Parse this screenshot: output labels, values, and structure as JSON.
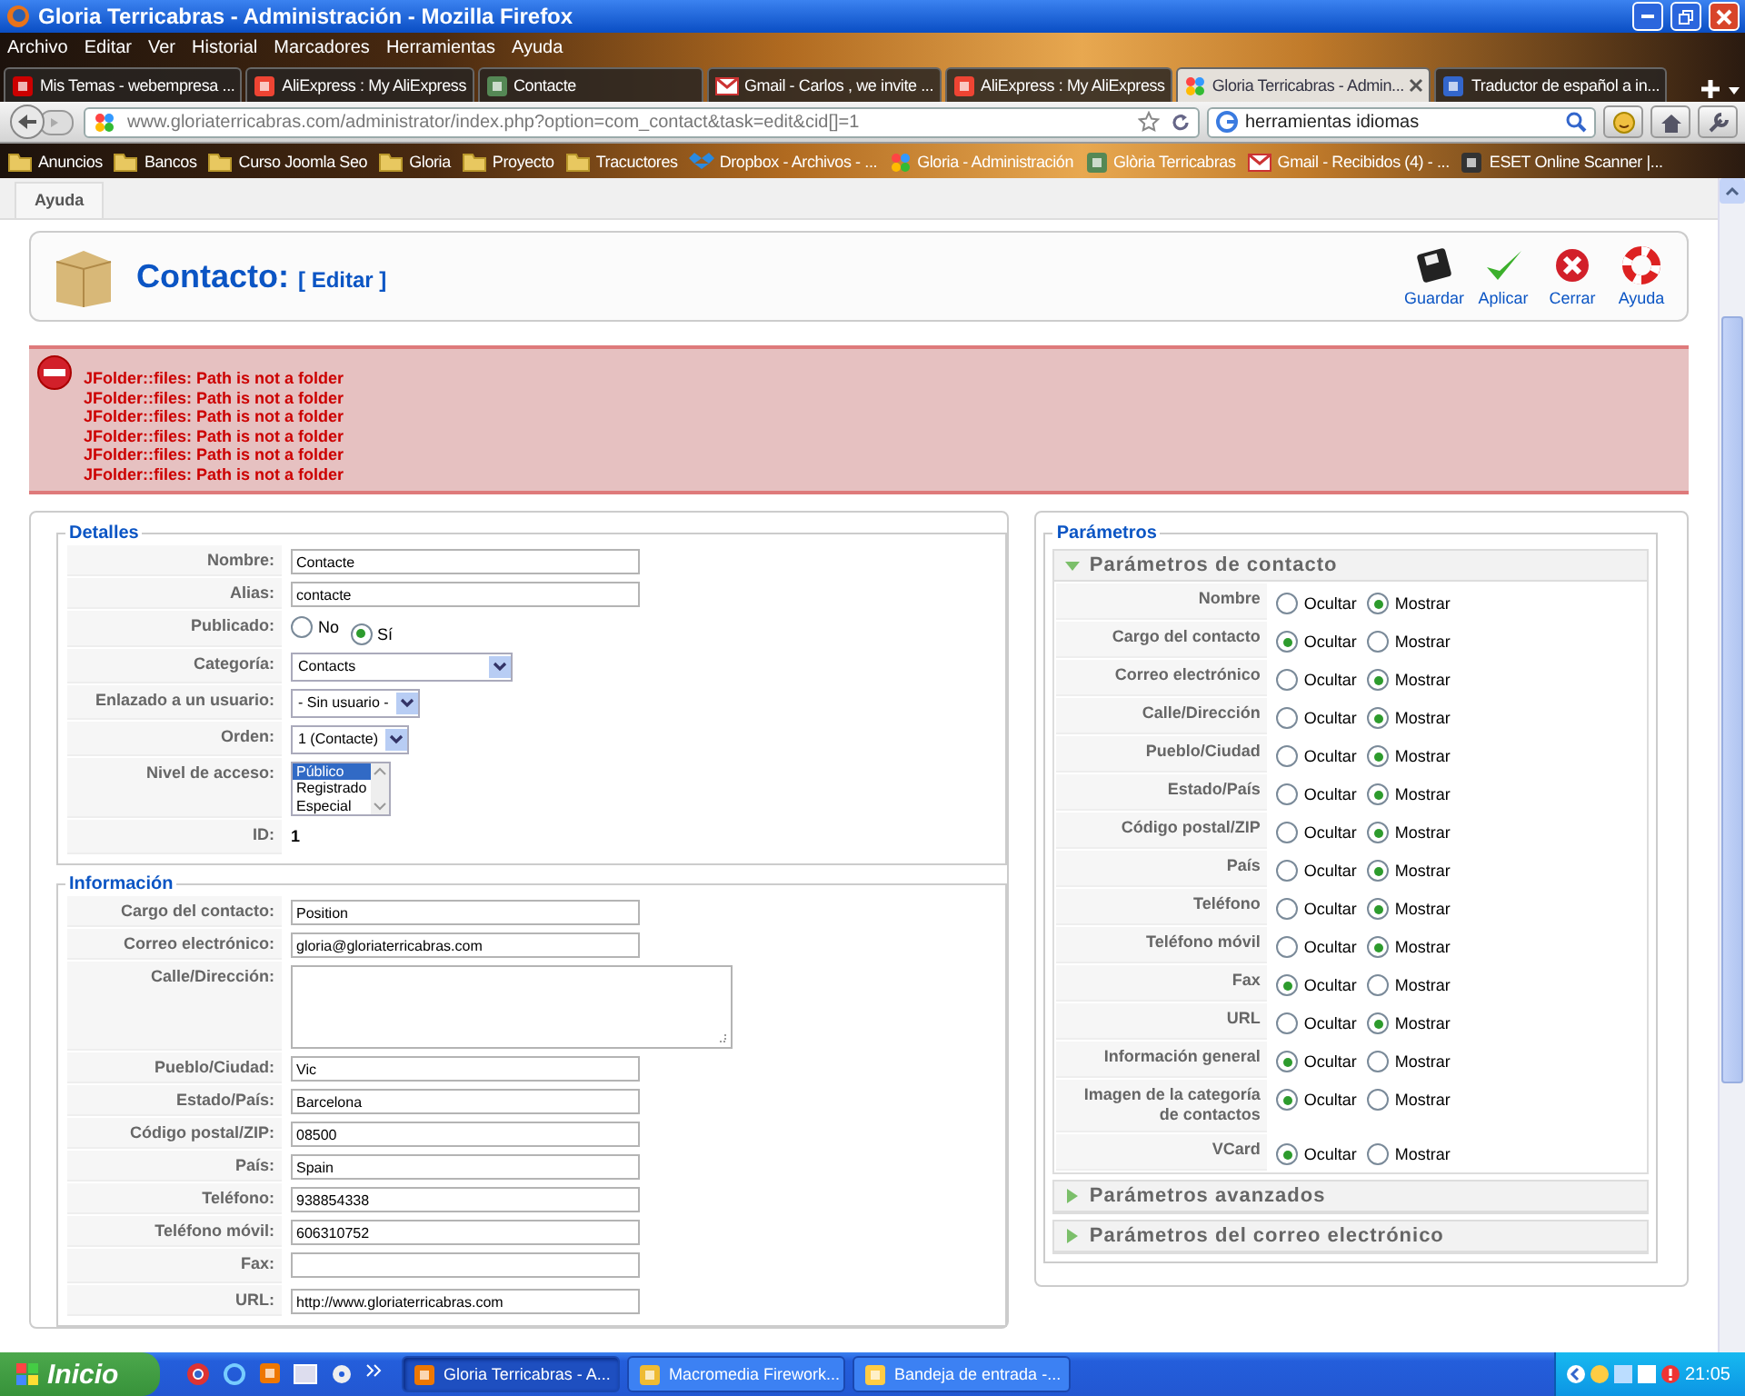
{
  "window": {
    "title": "Gloria Terricabras - Administración - Mozilla Firefox"
  },
  "menu_bar": [
    "Archivo",
    "Editar",
    "Ver",
    "Historial",
    "Marcadores",
    "Herramientas",
    "Ayuda"
  ],
  "tabs": [
    {
      "label": "Mis Temas - webempresa ...",
      "kind": "webempresa",
      "selected": false
    },
    {
      "label": "AliExpress : My AliExpress",
      "kind": "aliexpress",
      "selected": false
    },
    {
      "label": "Contacte",
      "kind": "contact",
      "selected": false
    },
    {
      "label": "Gmail - Carlos , we invite ...",
      "kind": "gmail",
      "selected": false
    },
    {
      "label": "AliExpress : My AliExpress",
      "kind": "aliexpress",
      "selected": false
    },
    {
      "label": "Gloria Terricabras - Admin...",
      "kind": "joomla",
      "selected": true
    },
    {
      "label": "Traductor de español a in...",
      "kind": "blogger",
      "selected": false
    }
  ],
  "address_bar": {
    "url": "www.gloriaterricabras.com/administrator/index.php?option=com_contact&task=edit&cid[]=1"
  },
  "search_field": {
    "value": "herramientas idiomas"
  },
  "bookmarks": [
    {
      "label": "Anuncios",
      "kind": "folder"
    },
    {
      "label": "Bancos",
      "kind": "folder"
    },
    {
      "label": "Curso Joomla Seo",
      "kind": "folder"
    },
    {
      "label": "Gloria",
      "kind": "folder"
    },
    {
      "label": "Proyecto",
      "kind": "folder"
    },
    {
      "label": "Tracuctores",
      "kind": "folder"
    },
    {
      "label": "Dropbox - Archivos - ...",
      "kind": "dropbox"
    },
    {
      "label": "Gloria - Administración",
      "kind": "joomla"
    },
    {
      "label": "Glòria Terricabras",
      "kind": "contact"
    },
    {
      "label": "Gmail - Recibidos (4) - ...",
      "kind": "gmail"
    },
    {
      "label": "ESET Online Scanner |...",
      "kind": "eset"
    }
  ],
  "submenu": {
    "tab": "Ayuda"
  },
  "toolbar": {
    "title": "Contacto:",
    "subtitle": "[ Editar ]",
    "buttons": [
      {
        "label": "Guardar",
        "kind": "save"
      },
      {
        "label": "Aplicar",
        "kind": "apply"
      },
      {
        "label": "Cerrar",
        "kind": "close"
      },
      {
        "label": "Ayuda",
        "kind": "help"
      }
    ]
  },
  "errors": [
    "JFolder::files: Path is not a folder",
    "JFolder::files: Path is not a folder",
    "JFolder::files: Path is not a folder",
    "JFolder::files: Path is not a folder",
    "JFolder::files: Path is not a folder",
    "JFolder::files: Path is not a folder"
  ],
  "details": {
    "legend": "Detalles",
    "fields": [
      {
        "label": "Nombre:",
        "kind": "text",
        "value": "Contacte"
      },
      {
        "label": "Alias:",
        "kind": "text",
        "value": "contacte"
      },
      {
        "label": "Publicado:",
        "kind": "radio",
        "options": [
          {
            "label": "No",
            "selected": false
          },
          {
            "label": "Sí",
            "selected": true
          }
        ]
      },
      {
        "label": "Categoría:",
        "kind": "select",
        "value": "Contacts"
      },
      {
        "label": "Enlazado a un usuario:",
        "kind": "select",
        "value": "- Sin usuario -"
      },
      {
        "label": "Orden:",
        "kind": "select",
        "value": "1 (Contacte)"
      },
      {
        "label": "Nivel de acceso:",
        "kind": "listbox",
        "options": [
          {
            "label": "Público",
            "selected": true
          },
          {
            "label": "Registrado",
            "selected": false
          },
          {
            "label": "Especial",
            "selected": false
          }
        ]
      },
      {
        "label": "ID:",
        "kind": "static",
        "value": "1"
      }
    ]
  },
  "information": {
    "legend": "Información",
    "fields": [
      {
        "label": "Cargo del contacto:",
        "kind": "text",
        "value": "Position"
      },
      {
        "label": "Correo electrónico:",
        "kind": "text",
        "value": "gloria@gloriaterricabras.com"
      },
      {
        "label": "Calle/Dirección:",
        "kind": "textarea"
      },
      {
        "label": "Pueblo/Ciudad:",
        "kind": "text",
        "value": "Vic"
      },
      {
        "label": "Estado/País:",
        "kind": "text",
        "value": "Barcelona"
      },
      {
        "label": "Código postal/ZIP:",
        "kind": "text",
        "value": "08500"
      },
      {
        "label": "País:",
        "kind": "text",
        "value": "Spain"
      },
      {
        "label": "Teléfono:",
        "kind": "text",
        "value": "938854338"
      },
      {
        "label": "Teléfono móvil:",
        "kind": "text",
        "value": "606310752"
      },
      {
        "label": "Fax:",
        "kind": "text"
      },
      {
        "label": "URL:",
        "kind": "text",
        "value": "http://www.gloriaterricabras.com"
      }
    ]
  },
  "parameters": {
    "legend": "Parámetros",
    "panels": [
      {
        "title": "Parámetros de contacto",
        "expanded": true,
        "rows": [
          {
            "label": "Nombre",
            "options": [
              {
                "label": "Ocultar",
                "selected": false
              },
              {
                "label": "Mostrar",
                "selected": true
              }
            ]
          },
          {
            "label": "Cargo del contacto",
            "options": [
              {
                "label": "Ocultar",
                "selected": true
              },
              {
                "label": "Mostrar",
                "selected": false
              }
            ]
          },
          {
            "label": "Correo electrónico",
            "options": [
              {
                "label": "Ocultar",
                "selected": false
              },
              {
                "label": "Mostrar",
                "selected": true
              }
            ]
          },
          {
            "label": "Calle/Dirección",
            "options": [
              {
                "label": "Ocultar",
                "selected": false
              },
              {
                "label": "Mostrar",
                "selected": true
              }
            ]
          },
          {
            "label": "Pueblo/Ciudad",
            "options": [
              {
                "label": "Ocultar",
                "selected": false
              },
              {
                "label": "Mostrar",
                "selected": true
              }
            ]
          },
          {
            "label": "Estado/País",
            "options": [
              {
                "label": "Ocultar",
                "selected": false
              },
              {
                "label": "Mostrar",
                "selected": true
              }
            ]
          },
          {
            "label": "Código postal/ZIP",
            "options": [
              {
                "label": "Ocultar",
                "selected": false
              },
              {
                "label": "Mostrar",
                "selected": true
              }
            ]
          },
          {
            "label": "País",
            "options": [
              {
                "label": "Ocultar",
                "selected": false
              },
              {
                "label": "Mostrar",
                "selected": true
              }
            ]
          },
          {
            "label": "Teléfono",
            "options": [
              {
                "label": "Ocultar",
                "selected": false
              },
              {
                "label": "Mostrar",
                "selected": true
              }
            ]
          },
          {
            "label": "Teléfono móvil",
            "options": [
              {
                "label": "Ocultar",
                "selected": false
              },
              {
                "label": "Mostrar",
                "selected": true
              }
            ]
          },
          {
            "label": "Fax",
            "options": [
              {
                "label": "Ocultar",
                "selected": true
              },
              {
                "label": "Mostrar",
                "selected": false
              }
            ]
          },
          {
            "label": "URL",
            "options": [
              {
                "label": "Ocultar",
                "selected": false
              },
              {
                "label": "Mostrar",
                "selected": true
              }
            ]
          },
          {
            "label": "Información general",
            "options": [
              {
                "label": "Ocultar",
                "selected": true
              },
              {
                "label": "Mostrar",
                "selected": false
              }
            ]
          },
          {
            "label": "Imagen de la categoría de contactos",
            "options": [
              {
                "label": "Ocultar",
                "selected": true
              },
              {
                "label": "Mostrar",
                "selected": false
              }
            ]
          },
          {
            "label": "VCard",
            "options": [
              {
                "label": "Ocultar",
                "selected": true
              },
              {
                "label": "Mostrar",
                "selected": false
              }
            ]
          }
        ]
      },
      {
        "title": "Parámetros avanzados",
        "expanded": false
      },
      {
        "title": "Parámetros del correo electrónico",
        "expanded": false
      }
    ]
  },
  "taskbar": {
    "start": "Inicio",
    "items": [
      {
        "label": "Gloria Terricabras - A...",
        "kind": "firefox",
        "selected": true
      },
      {
        "label": "Macromedia Firework...",
        "kind": "fireworks",
        "selected": false
      },
      {
        "label": "Bandeja de entrada -...",
        "kind": "mail",
        "selected": false
      }
    ],
    "clock": "21:05"
  }
}
